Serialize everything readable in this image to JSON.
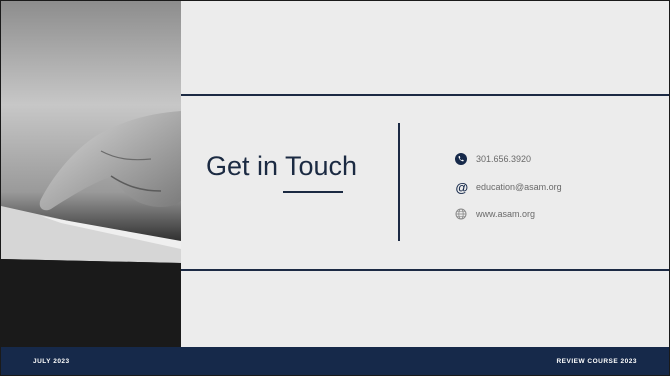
{
  "slide": {
    "title": "Get in Touch",
    "contacts": [
      {
        "icon": "phone-icon",
        "text": "301.656.3920"
      },
      {
        "icon": "at-icon",
        "text": "education@asam.org"
      },
      {
        "icon": "globe-icon",
        "text": "www.asam.org"
      }
    ],
    "footer": {
      "left": "JULY 2023",
      "right": "REVIEW COURSE 2023"
    }
  },
  "colors": {
    "navy": "#16294a",
    "background": "#ececec",
    "text_gray": "#6a6a6a"
  }
}
